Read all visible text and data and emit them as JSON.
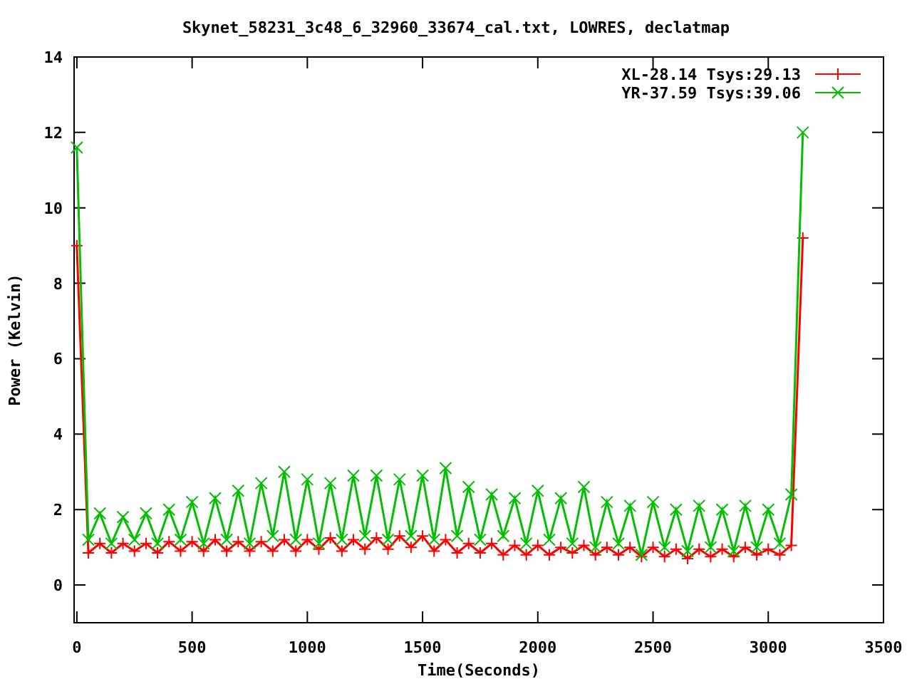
{
  "plot": {
    "chart_data": {
      "type": "line",
      "title": "Skynet_58231_3c48_6_32960_33674_cal.txt, LOWRES, declatmap",
      "xlabel": "Time(Seconds)",
      "ylabel": "Power (Kelvin)",
      "x": [
        0,
        50,
        100,
        150,
        200,
        250,
        300,
        350,
        400,
        450,
        500,
        550,
        600,
        650,
        700,
        750,
        800,
        850,
        900,
        950,
        1000,
        1050,
        1100,
        1150,
        1200,
        1250,
        1300,
        1350,
        1400,
        1450,
        1500,
        1550,
        1600,
        1650,
        1700,
        1750,
        1800,
        1850,
        1900,
        1950,
        2000,
        2050,
        2100,
        2150,
        2200,
        2250,
        2300,
        2350,
        2400,
        2450,
        2500,
        2550,
        2600,
        2650,
        2700,
        2750,
        2800,
        2850,
        2900,
        2950,
        3000,
        3050,
        3100,
        3150
      ],
      "series": [
        {
          "name": "XL-28.14 Tsys:29.13",
          "color": "#ff0000",
          "marker": "plus",
          "values": [
            9.0,
            0.85,
            1.1,
            0.85,
            1.1,
            0.9,
            1.1,
            0.85,
            1.15,
            0.9,
            1.15,
            0.9,
            1.2,
            0.9,
            1.15,
            0.9,
            1.15,
            0.9,
            1.2,
            0.9,
            1.2,
            0.95,
            1.25,
            0.9,
            1.2,
            0.95,
            1.25,
            0.95,
            1.3,
            1.0,
            1.3,
            0.9,
            1.2,
            0.85,
            1.1,
            0.85,
            1.1,
            0.8,
            1.05,
            0.8,
            1.05,
            0.8,
            1.0,
            0.85,
            1.05,
            0.8,
            1.0,
            0.8,
            1.0,
            0.75,
            1.0,
            0.75,
            0.95,
            0.7,
            0.95,
            0.75,
            0.95,
            0.75,
            1.0,
            0.8,
            0.95,
            0.8,
            1.05,
            9.2
          ]
        },
        {
          "name": "YR-37.59 Tsys:39.06",
          "color": "#00c000",
          "marker": "cross",
          "values": [
            11.6,
            1.2,
            1.9,
            1.1,
            1.8,
            1.2,
            1.9,
            1.1,
            2.0,
            1.2,
            2.2,
            1.1,
            2.3,
            1.2,
            2.5,
            1.1,
            2.7,
            1.3,
            3.0,
            1.2,
            2.8,
            1.1,
            2.7,
            1.2,
            2.9,
            1.3,
            2.9,
            1.2,
            2.8,
            1.3,
            2.9,
            1.2,
            3.1,
            1.3,
            2.6,
            1.2,
            2.4,
            1.3,
            2.3,
            1.1,
            2.5,
            1.2,
            2.3,
            1.1,
            2.6,
            1.0,
            2.2,
            1.1,
            2.1,
            0.8,
            2.2,
            1.0,
            2.0,
            0.9,
            2.1,
            1.0,
            2.0,
            0.9,
            2.1,
            1.0,
            2.0,
            1.1,
            2.4,
            12.0
          ]
        }
      ],
      "legend": "upper right",
      "xlim": [
        -12,
        3500
      ],
      "ylim": [
        -1,
        14
      ],
      "xticks": [
        0,
        500,
        1000,
        1500,
        2000,
        2500,
        3000,
        3500
      ],
      "yticks": [
        0,
        2,
        4,
        6,
        8,
        10,
        12,
        14
      ]
    }
  }
}
